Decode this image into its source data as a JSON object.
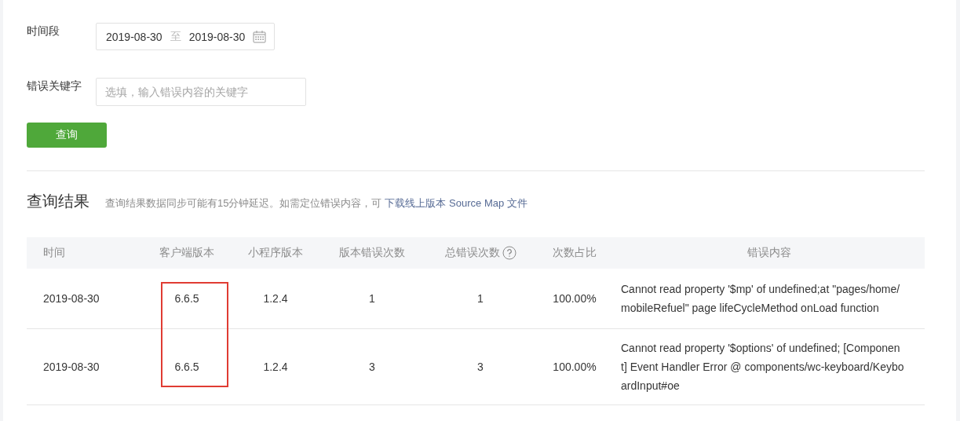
{
  "filters": {
    "date_range": {
      "label": "时间段",
      "start": "2019-08-30",
      "separator": "至",
      "end": "2019-08-30"
    },
    "keyword": {
      "label": "错误关键字",
      "placeholder": "选填，输入错误内容的关键字"
    },
    "query_button": "查询"
  },
  "results": {
    "title": "查询结果",
    "note": "查询结果数据同步可能有15分钟延迟。如需定位错误内容，可",
    "link": "下载线上版本 Source Map 文件"
  },
  "table": {
    "columns": [
      {
        "label": "时间",
        "help": false,
        "highlighted": false
      },
      {
        "label": "客户端版本",
        "help": false,
        "highlighted": true
      },
      {
        "label": "小程序版本",
        "help": false,
        "highlighted": false
      },
      {
        "label": "版本错误次数",
        "help": false,
        "highlighted": false
      },
      {
        "label": "总错误次数",
        "help": true,
        "highlighted": false
      },
      {
        "label": "次数占比",
        "help": false,
        "highlighted": false
      },
      {
        "label": "错误内容",
        "help": false,
        "highlighted": false
      }
    ],
    "rows": [
      [
        "2019-08-30",
        "6.6.5",
        "1.2.4",
        "1",
        "1",
        "100.00%",
        "Cannot read property '$mp' of undefined;at \"pages/home/mobileRefuel\" page lifeCycleMethod onLoad function"
      ],
      [
        "2019-08-30",
        "6.6.5",
        "1.2.4",
        "3",
        "3",
        "100.00%",
        "Cannot read property '$options' of undefined; [Component] Event Handler Error @ components/wc-keyboard/KeyboardInput#oe"
      ]
    ]
  }
}
